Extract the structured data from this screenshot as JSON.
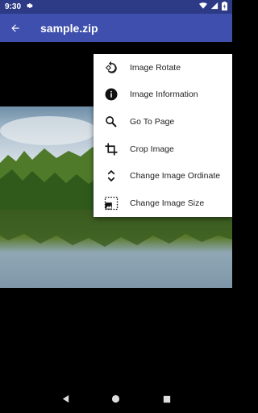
{
  "status_bar": {
    "time": "9:30"
  },
  "app_bar": {
    "title": "sample.zip"
  },
  "menu": {
    "items": [
      {
        "label": "Image Rotate",
        "icon": "rotate-icon"
      },
      {
        "label": "Image Information",
        "icon": "info-icon"
      },
      {
        "label": "Go To Page",
        "icon": "search-icon"
      },
      {
        "label": "Crop Image",
        "icon": "crop-icon"
      },
      {
        "label": "Change Image Ordinate",
        "icon": "ordinate-icon"
      },
      {
        "label": "Change Image Size",
        "icon": "image-size-icon"
      }
    ]
  },
  "colors": {
    "status_bar": "#2d3a86",
    "app_bar": "#3e4fad",
    "menu_bg": "#ffffff"
  }
}
